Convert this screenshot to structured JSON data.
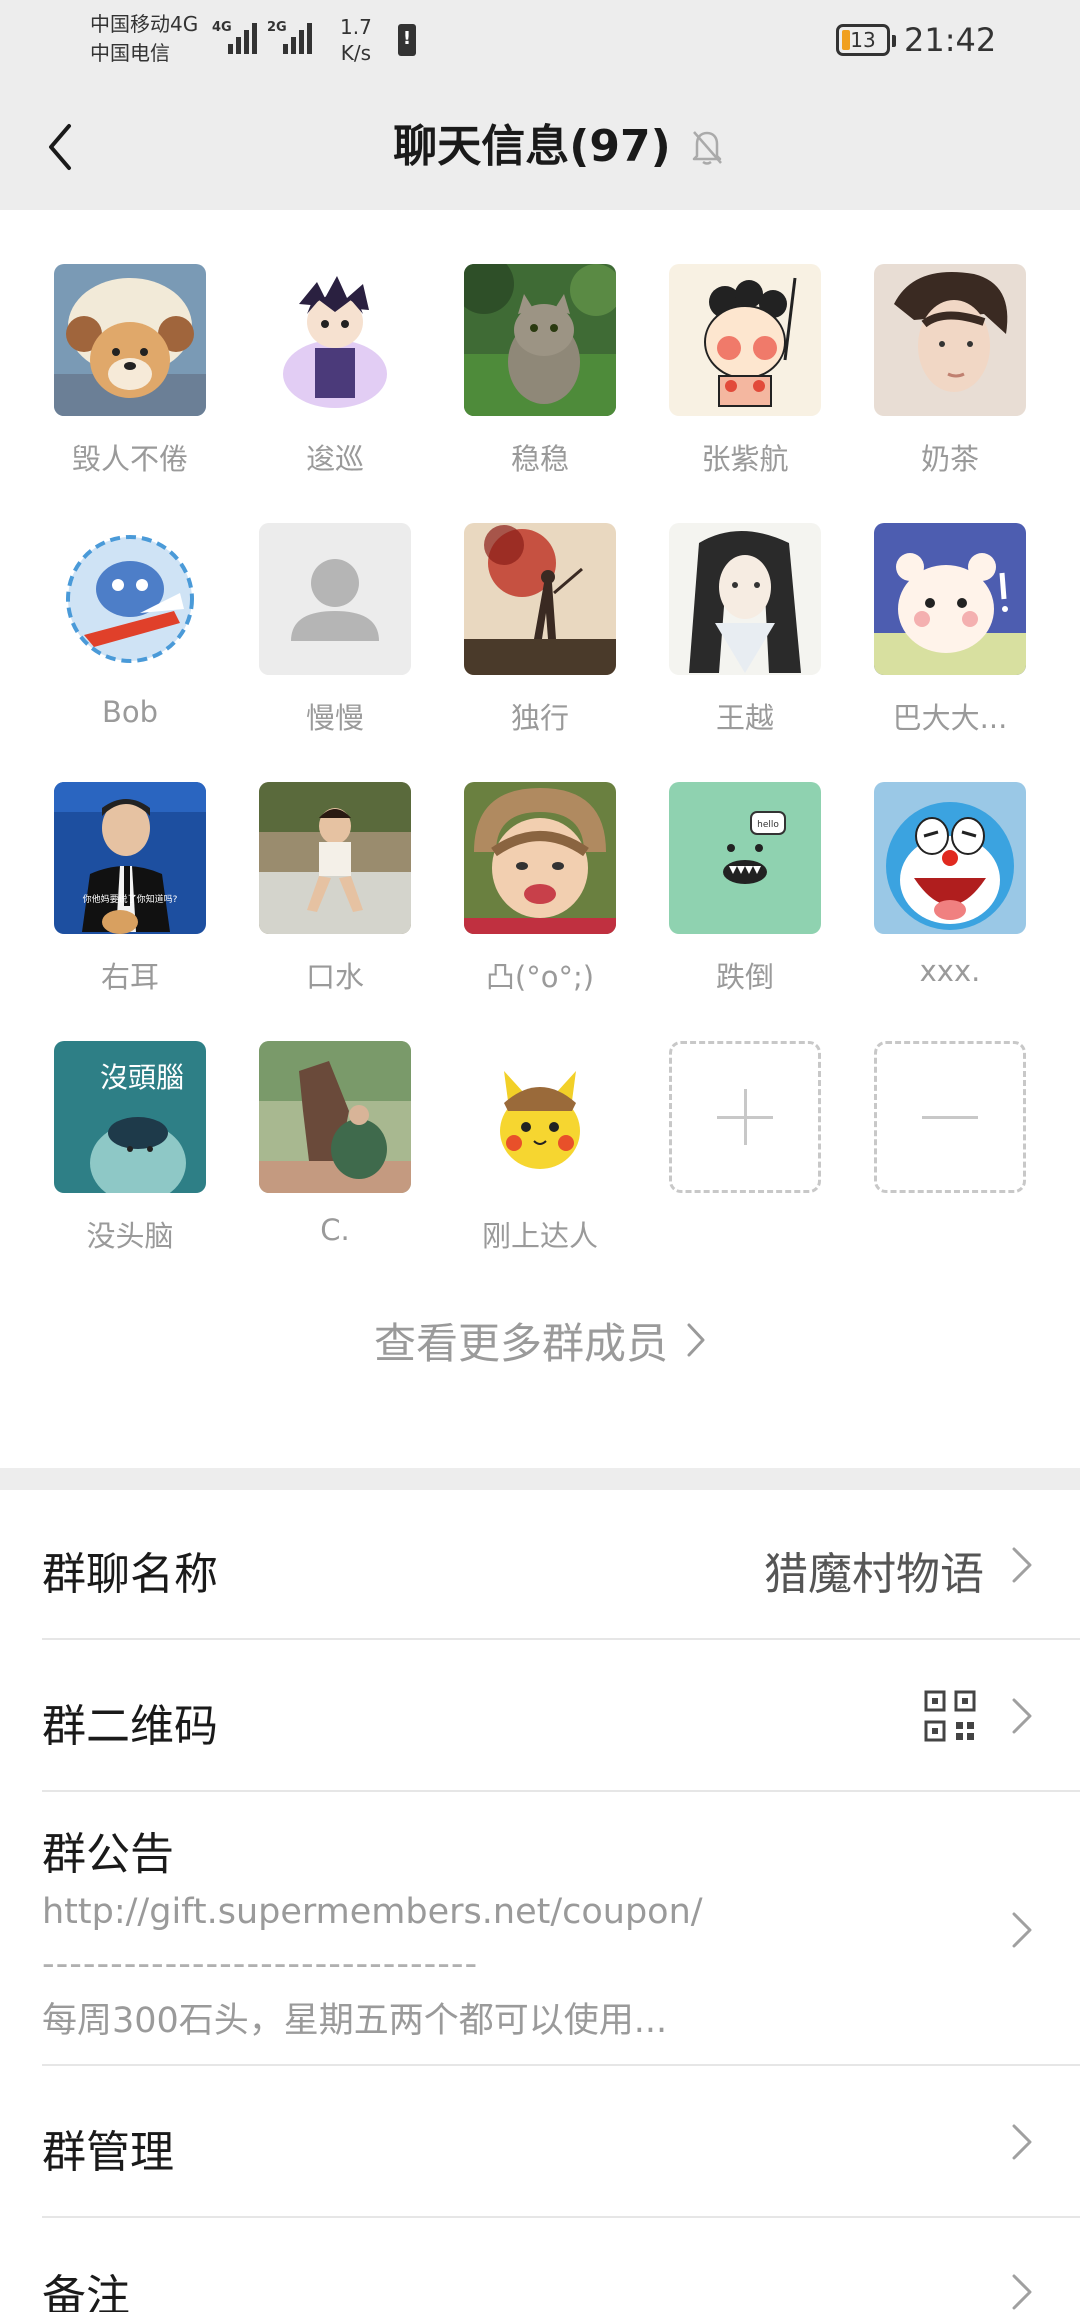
{
  "status_bar": {
    "carrier_1": "中国移动4G",
    "carrier_2": "中国电信",
    "signal_1_tag": "4G",
    "signal_2_tag": "2G",
    "speed_value": "1.7",
    "speed_unit": "K/s",
    "battery": "13",
    "time": "21:42"
  },
  "header": {
    "title": "聊天信息(97)",
    "back_icon": "chevron-left-icon",
    "mute_icon": "bell-off-icon"
  },
  "members": [
    {
      "name": "毁人不倦"
    },
    {
      "name": "逡巡"
    },
    {
      "name": "稳稳"
    },
    {
      "name": "张紫航"
    },
    {
      "name": "奶茶"
    },
    {
      "name": "Bob"
    },
    {
      "name": "慢慢"
    },
    {
      "name": "独行"
    },
    {
      "name": "王越"
    },
    {
      "name": "巴大大..."
    },
    {
      "name": "右耳"
    },
    {
      "name": "口水"
    },
    {
      "name": "凸(°o°;)"
    },
    {
      "name": "跌倒"
    },
    {
      "name": "xxx."
    },
    {
      "name": "没头脑"
    },
    {
      "name": "C."
    },
    {
      "name": "刚上达人"
    }
  ],
  "avatar_texts": {
    "meme_caption": "你他妈要说了你知道吗?",
    "book_title": "沒頭腦",
    "bubble_text": "hello"
  },
  "member_controls": {
    "add_icon": "plus-icon",
    "remove_icon": "minus-icon"
  },
  "more_members": "查看更多群成员",
  "settings": {
    "group_name_label": "群聊名称",
    "group_name_value": "猎魔村物语",
    "qr_label": "群二维码",
    "qr_icon": "qr-code-icon",
    "notice_label": "群公告",
    "notice_url": "http://gift.supermembers.net/coupon/",
    "notice_separator": "--------------------------------",
    "notice_text": "每周300石头，星期五两个都可以使用...",
    "manage_label": "群管理",
    "remark_label": "备注"
  },
  "colors": {
    "header_bg": "#ededed",
    "text_primary": "#1a1a1a",
    "text_secondary": "#9a9a9a",
    "battery_low": "#f0a020"
  }
}
